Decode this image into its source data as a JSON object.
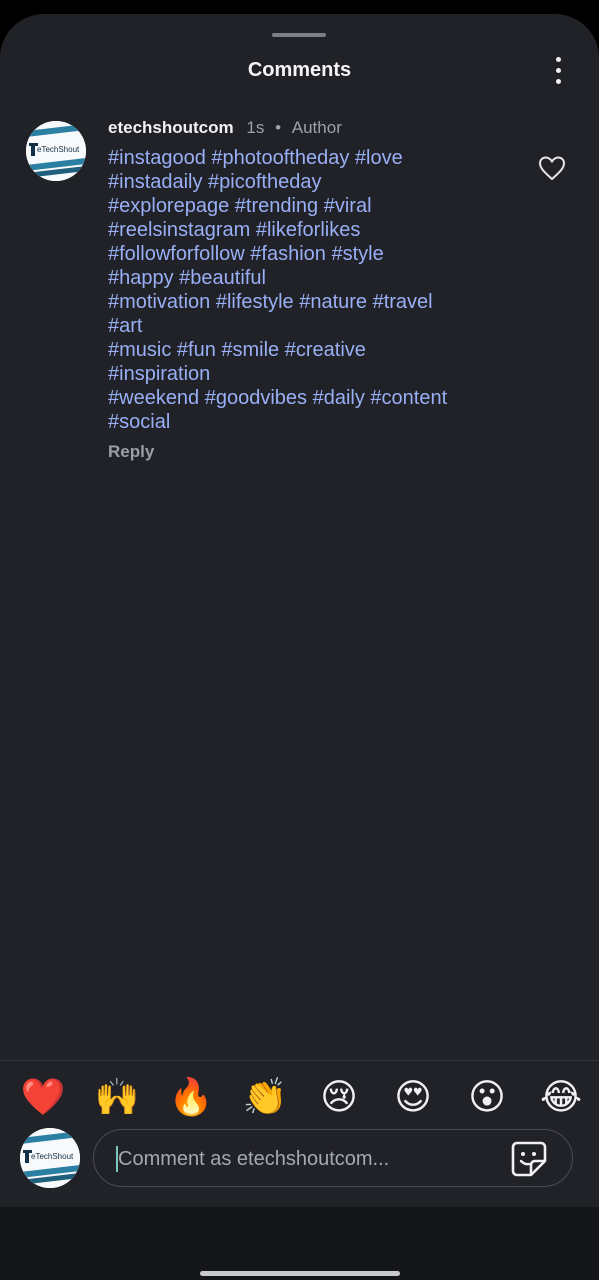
{
  "header": {
    "title": "Comments",
    "more_icon": "kebab-menu-icon"
  },
  "comment": {
    "avatar_text": "eTechShout",
    "username": "etechshoutcom",
    "time": "1s",
    "separator": "•",
    "role": "Author",
    "lines": [
      "#instagood #photooftheday #love",
      "#instadaily #picoftheday",
      "#explorepage #trending #viral",
      "#reelsinstagram #likeforlikes",
      "#followforfollow #fashion #style",
      "#happy #beautiful",
      "#motivation #lifestyle #nature #travel",
      "#art",
      "#music #fun #smile #creative",
      "#inspiration",
      "#weekend #goodvibes #daily #content",
      "#social"
    ],
    "reply_label": "Reply",
    "like_icon": "heart-outline-icon"
  },
  "reactions": [
    "❤️",
    "🙌",
    "🔥",
    "👏",
    "😢",
    "😍",
    "😮",
    "😂"
  ],
  "composer": {
    "avatar_text": "eTechShout",
    "placeholder": "Comment as etechshoutcom...",
    "sticker_icon": "sticker-icon"
  },
  "colors": {
    "background": "#212227",
    "hashtag": "#98aff6",
    "muted": "#9fa1a8",
    "caret": "#77c6c0"
  }
}
